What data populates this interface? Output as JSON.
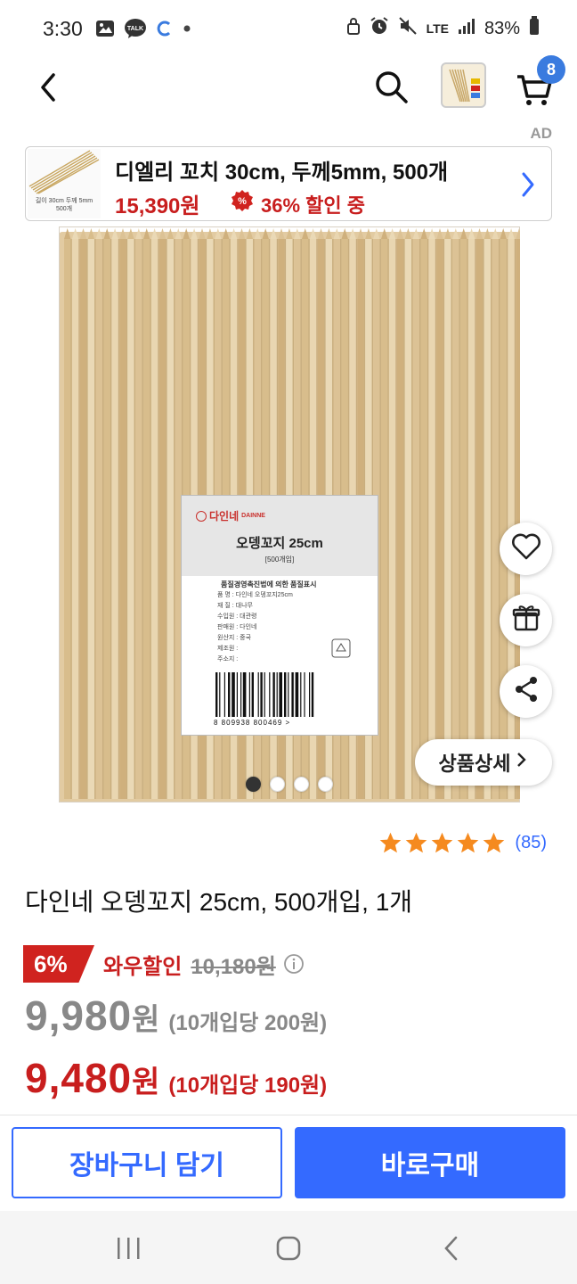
{
  "status_bar": {
    "time": "3:30",
    "left_icons": [
      "image-icon",
      "talk-icon",
      "c-app-icon",
      "dot-icon"
    ],
    "talk_label": "TALK",
    "network": "LTE",
    "battery": "83%"
  },
  "header": {
    "cart_count": "8"
  },
  "ad": {
    "tag": "AD",
    "title": "디엘리 꼬치 30cm, 두께5mm, 500개",
    "price": "15,390원",
    "discount": "36% 할인 중",
    "image_caption_line1": "길이 30cm 두께 5mm",
    "image_caption_line2": "500개"
  },
  "product_image": {
    "label_brand": "다인네",
    "label_brand_sub": "DAINNE",
    "label_name": "오뎅꼬지 25cm",
    "label_count": "[500개입]",
    "label_info_title": "품질경영촉진법에 의한 품질표시",
    "label_lines": [
      "품 명 : 다인네 오뎅꼬지25cm",
      "재 질 : 대나무",
      "수입원 : 대관령",
      "판매원 : 다인네",
      "원산지 : 중국",
      "제조원 :",
      "주소지 :"
    ],
    "barcode_number": "8  809938  800469  >",
    "slides_total": 4,
    "slides_active": 1
  },
  "side_actions": [
    "heart-icon",
    "gift-icon",
    "share-icon"
  ],
  "detail_button": "상품상세",
  "rating": {
    "stars": 5,
    "count": "(85)"
  },
  "product": {
    "title": "다인네 오뎅꼬지 25cm, 500개입, 1개",
    "wow_discount": "6%",
    "wow_label": "와우할인",
    "original_price": "10,180원",
    "price_number": "9,980",
    "price_won": "원",
    "price_unit": "(10개입당 200원)",
    "wow_price_number": "9,480",
    "wow_price_won": "원",
    "wow_price_unit": "(10개입당 190원)"
  },
  "buttons": {
    "add_to_cart": "장바구니 담기",
    "buy_now": "바로구매"
  },
  "colors": {
    "accent_blue": "#346aff",
    "sale_red": "#c81e1e",
    "star_orange": "#f58a1f"
  }
}
